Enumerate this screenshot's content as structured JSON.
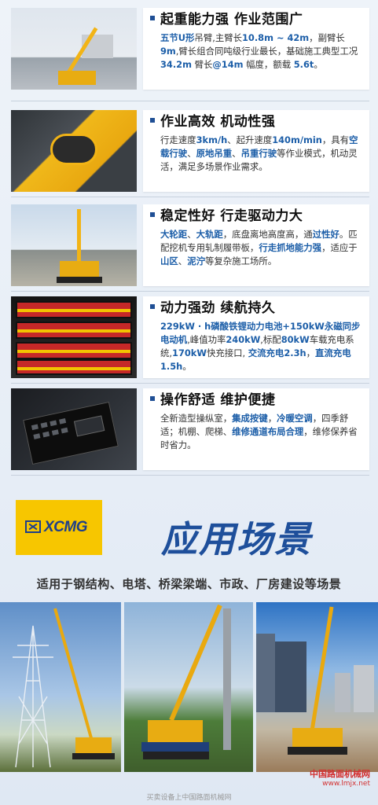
{
  "features": [
    {
      "title": "起重能力强  作业范围广",
      "desc": [
        {
          "t": "五节U形",
          "hl": true
        },
        {
          "t": "吊臂,主臂长"
        },
        {
          "t": "10.8m ~ 42m",
          "hl": true
        },
        {
          "t": "，副臂长"
        },
        {
          "t": "9m",
          "hl": true
        },
        {
          "t": ",臂长组合同吨级行业最长，基础施工典型工况 "
        },
        {
          "t": "34.2m",
          "hl": true
        },
        {
          "t": " 臂长"
        },
        {
          "t": "@14m",
          "hl": true
        },
        {
          "t": " 幅度，额载 "
        },
        {
          "t": "5.6t",
          "hl": true
        },
        {
          "t": "。"
        }
      ]
    },
    {
      "title": "作业高效  机动性强",
      "desc": [
        {
          "t": "行走速度"
        },
        {
          "t": "3km/h",
          "hl": true
        },
        {
          "t": "、起升速度"
        },
        {
          "t": "140m/min",
          "hl": true
        },
        {
          "t": "，具有"
        },
        {
          "t": "空载行驶",
          "hl": true
        },
        {
          "t": "、"
        },
        {
          "t": "原地吊重",
          "hl": true
        },
        {
          "t": "、"
        },
        {
          "t": "吊重行驶",
          "hl": true
        },
        {
          "t": "等作业模式，机动灵活，满足多场景作业需求。"
        }
      ]
    },
    {
      "title": "稳定性好  行走驱动力大",
      "desc": [
        {
          "t": "大轮距",
          "hl": true
        },
        {
          "t": "、"
        },
        {
          "t": "大轨距",
          "hl": true
        },
        {
          "t": "，底盘离地高度高，通"
        },
        {
          "t": "过性好",
          "hl": true
        },
        {
          "t": "。匹配挖机专用轧制履带板，"
        },
        {
          "t": "行走抓地能力强",
          "hl": true
        },
        {
          "t": "，适应于"
        },
        {
          "t": "山区",
          "hl": true
        },
        {
          "t": "、"
        },
        {
          "t": "泥泞",
          "hl": true
        },
        {
          "t": "等复杂施工场所。"
        }
      ]
    },
    {
      "title": "动力强劲  续航持久",
      "desc": [
        {
          "t": "229kW · h磷酸铁锂动力电池+150kW永磁同步电动机",
          "hl": true
        },
        {
          "t": ",峰值功率"
        },
        {
          "t": "240kW",
          "hl": true
        },
        {
          "t": ",标配"
        },
        {
          "t": "80kW",
          "hl": true
        },
        {
          "t": "车载充电系统,"
        },
        {
          "t": "170kW",
          "hl": true
        },
        {
          "t": "快充接口, "
        },
        {
          "t": "交流充电2.3h",
          "hl": true
        },
        {
          "t": "，"
        },
        {
          "t": "直流充电1.5h",
          "hl": true
        },
        {
          "t": "。"
        }
      ]
    },
    {
      "title": "操作舒适  维护便捷",
      "desc": [
        {
          "t": "全新造型操纵室，"
        },
        {
          "t": "集成按键",
          "hl": true
        },
        {
          "t": "，"
        },
        {
          "t": "冷暖空调",
          "hl": true
        },
        {
          "t": "，四季舒适；机棚、爬梯、"
        },
        {
          "t": "维修通道布局合理",
          "hl": true
        },
        {
          "t": "，维修保养省时省力。"
        }
      ]
    }
  ],
  "logo": {
    "brand": "XCMG"
  },
  "section": {
    "title": "应用场景",
    "subtitle": "适用于钢结构、电塔、桥梁梁端、市政、厂房建设等场景"
  },
  "watermark": {
    "line1": "中国路面机械网",
    "line2": "www.lmjx.net"
  },
  "footer": "买卖设备上中国路面机械网",
  "colors": {
    "accent": "#1c5ea8",
    "brand_yellow": "#f7c600",
    "brand_blue": "#1e3f8a"
  }
}
